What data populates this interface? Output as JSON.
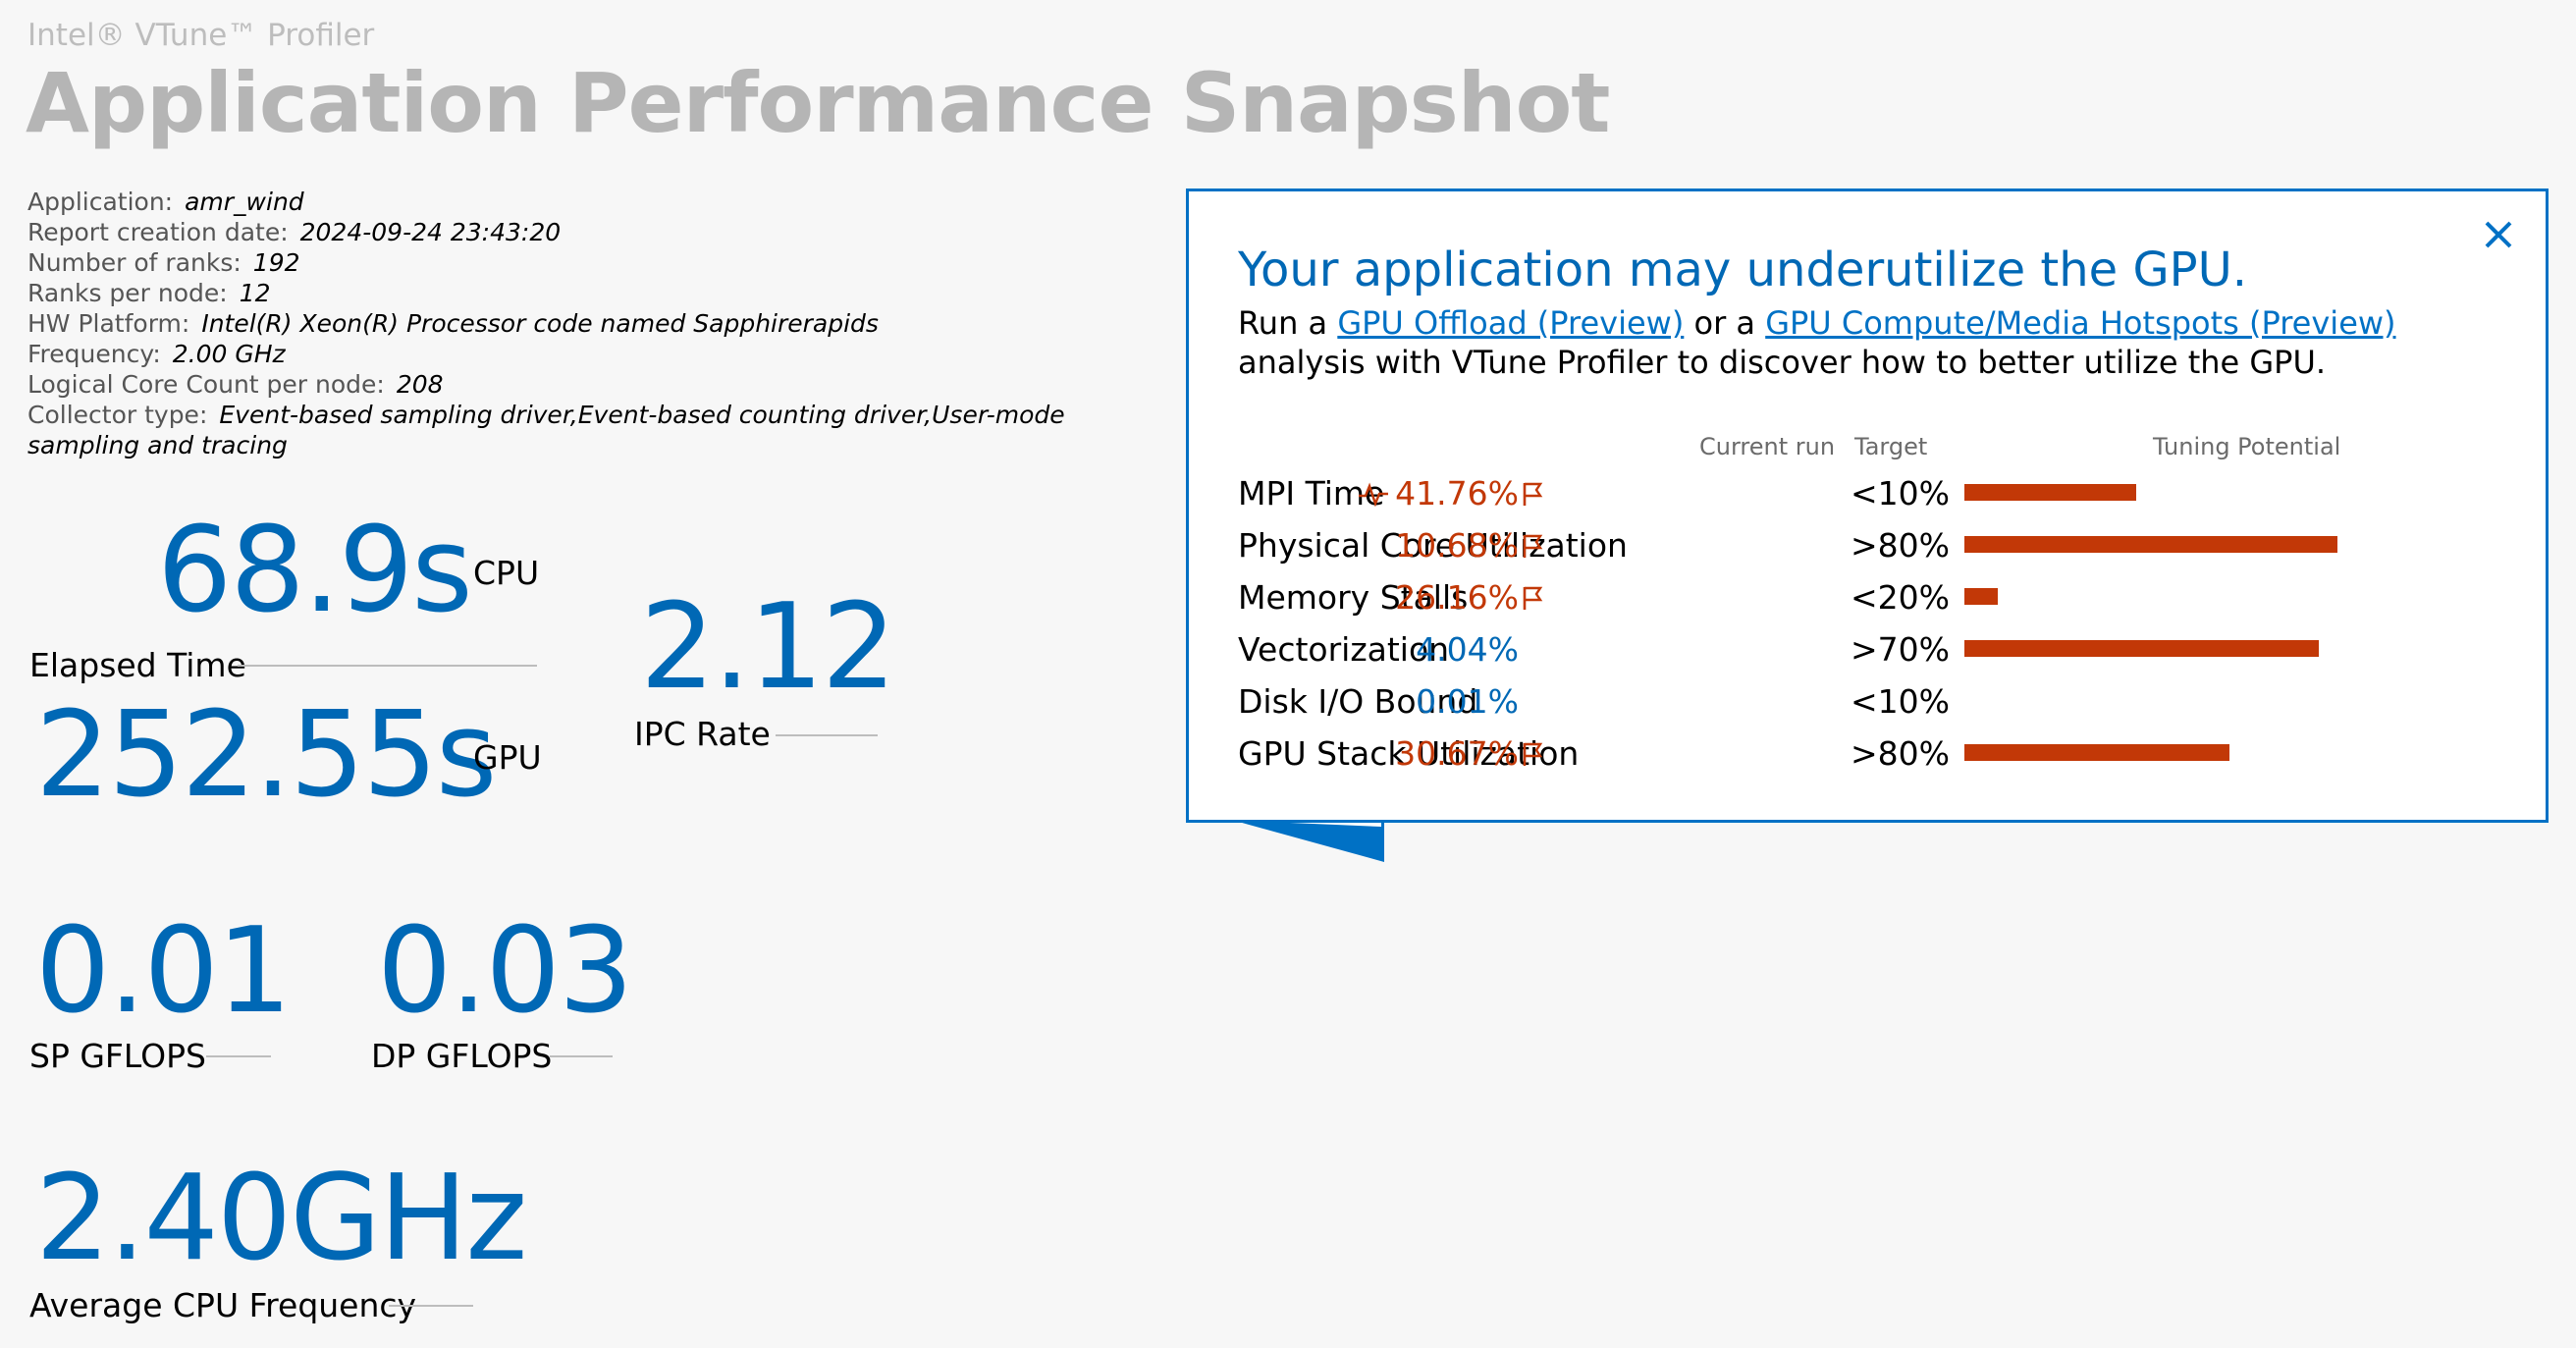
{
  "header": {
    "brand": "Intel® VTune™ Profiler",
    "title": "Application Performance Snapshot"
  },
  "info": [
    {
      "label": "Application:",
      "value": "amr_wind"
    },
    {
      "label": "Report creation date:",
      "value": "2024-09-24 23:43:20"
    },
    {
      "label": "Number of ranks:",
      "value": "192"
    },
    {
      "label": "Ranks per node:",
      "value": "12"
    },
    {
      "label": "HW Platform:",
      "value": "Intel(R) Xeon(R) Processor code named Sapphirerapids"
    },
    {
      "label": "Frequency:",
      "value": "2.00 GHz"
    },
    {
      "label": "Logical Core Count per node:",
      "value": "208"
    },
    {
      "label": "Collector type:",
      "value": "Event-based sampling driver,Event-based counting driver,User-mode sampling and tracing"
    }
  ],
  "metrics": {
    "elapsed": {
      "cpu_value": "68.9s",
      "cpu_unit": "CPU",
      "gpu_value": "252.55s",
      "gpu_unit": "GPU",
      "label": "Elapsed Time"
    },
    "ipc": {
      "value": "2.12",
      "label": "IPC Rate"
    },
    "sp": {
      "value": "0.01",
      "label": "SP GFLOPS"
    },
    "dp": {
      "value": "0.03",
      "label": "DP GFLOPS"
    },
    "freq": {
      "value": "2.40GHz",
      "label": "Average CPU Frequency"
    }
  },
  "panel": {
    "title": "Your application may underutilize the GPU.",
    "text_1": "Run a ",
    "link_1": "GPU Offload (Preview)",
    "text_2": " or a ",
    "link_2": "GPU Compute/Media Hotspots (Preview)",
    "text_3": " analysis with VTune Profiler to discover how to better utilize the GPU.",
    "columns": {
      "current": "Current run",
      "target": "Target",
      "tuning": "Tuning Potential"
    },
    "rows": [
      {
        "name": "MPI Time",
        "current": "41.76%",
        "target": "<10%",
        "tuning": 0.46,
        "flag": true,
        "spark": true,
        "color": "#c23807"
      },
      {
        "name": "Physical Core Utilization",
        "current": "10.68%",
        "target": ">80%",
        "tuning": 1.0,
        "flag": true,
        "spark": false,
        "color": "#c23807"
      },
      {
        "name": "Memory Stalls",
        "current": "26.16%",
        "target": "<20%",
        "tuning": 0.09,
        "flag": true,
        "spark": false,
        "color": "#c23807"
      },
      {
        "name": "Vectorization",
        "current": "4.04%",
        "target": ">70%",
        "tuning": 0.95,
        "flag": false,
        "spark": false,
        "color": "#0068b5"
      },
      {
        "name": "Disk I/O Bound",
        "current": "0.01%",
        "target": "<10%",
        "tuning": 0,
        "flag": false,
        "spark": false,
        "color": "#0068b5"
      },
      {
        "name": "GPU Stack Utilization",
        "current": "30.67%",
        "target": ">80%",
        "tuning": 0.71,
        "flag": true,
        "spark": false,
        "color": "#c23807"
      }
    ]
  },
  "colors": {
    "accent": "#0068b5",
    "border": "#0071c5",
    "bar": "#c23807",
    "muted_title": "#b5b5b5"
  }
}
